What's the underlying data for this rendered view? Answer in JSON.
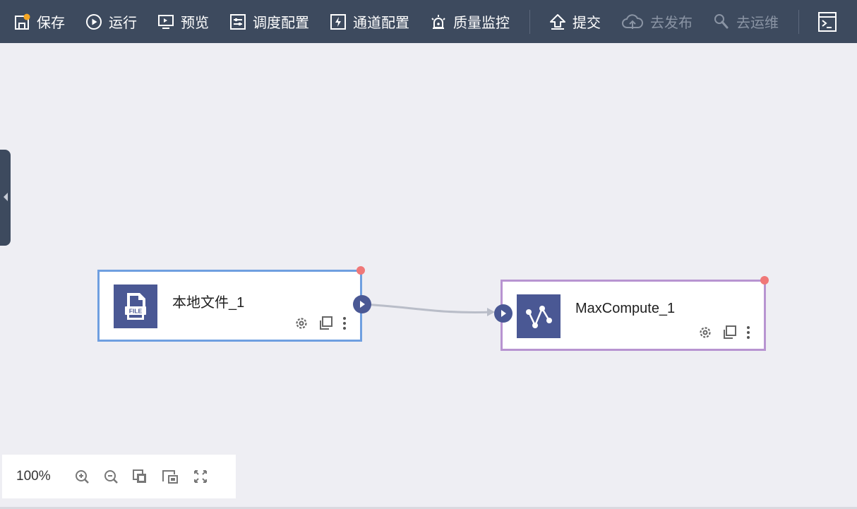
{
  "toolbar": {
    "save": "保存",
    "run": "运行",
    "preview": "预览",
    "schedule_config": "调度配置",
    "channel_config": "通道配置",
    "quality_monitor": "质量监控",
    "submit": "提交",
    "publish": "去发布",
    "operations": "去运维"
  },
  "nodes": [
    {
      "title": "本地文件_1",
      "icon": "file-icon",
      "icon_text": "FILE",
      "border_color": "#6f9fe0"
    },
    {
      "title": "MaxCompute_1",
      "icon": "maxcompute-icon",
      "border_color": "#b894d1"
    }
  ],
  "zoom": {
    "level": "100%"
  },
  "colors": {
    "toolbar_bg": "#3d4a5e",
    "canvas_bg": "#eeeef3",
    "node_icon_bg": "#4a5894",
    "status_dot": "#f07878",
    "save_badge": "#f5a623"
  }
}
